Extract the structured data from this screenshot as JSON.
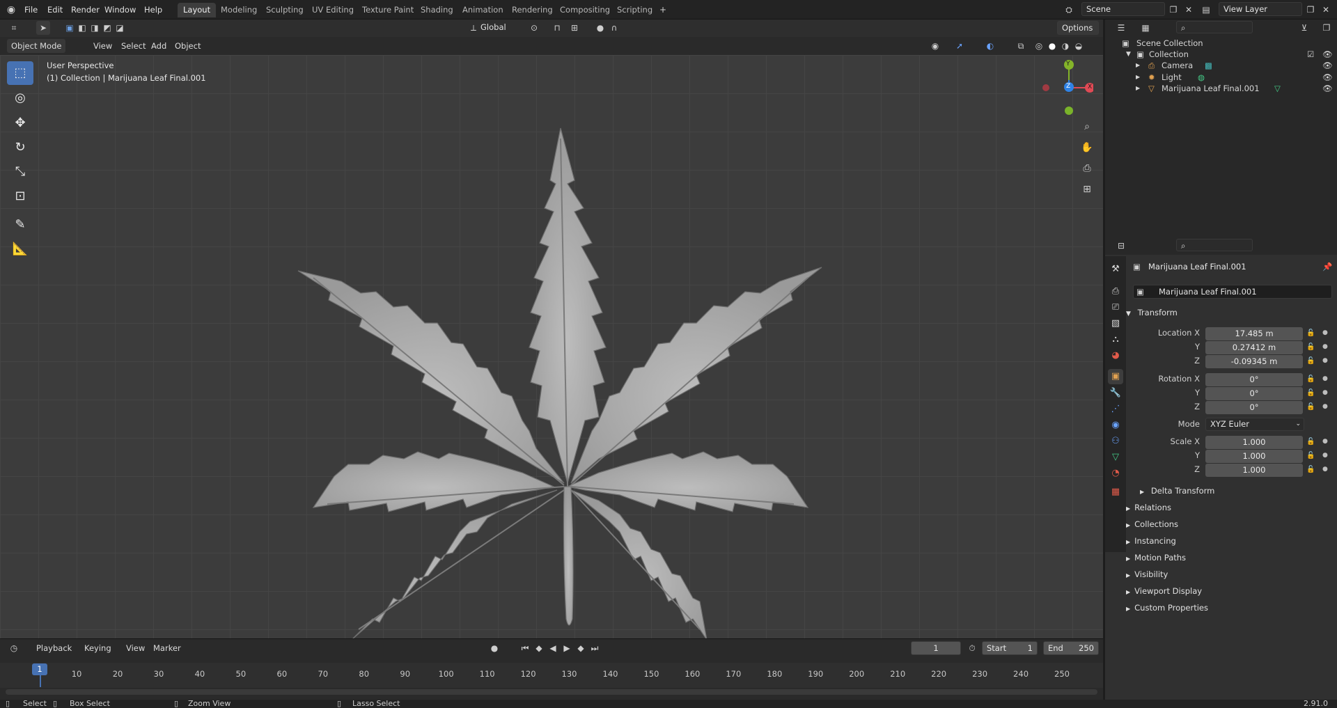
{
  "menu": {
    "file": "File",
    "edit": "Edit",
    "render": "Render",
    "window": "Window",
    "help": "Help"
  },
  "workspaces": [
    "Layout",
    "Modeling",
    "Sculpting",
    "UV Editing",
    "Texture Paint",
    "Shading",
    "Animation",
    "Rendering",
    "Compositing",
    "Scripting"
  ],
  "add_tab_icon": "+",
  "scene": {
    "name": "Scene",
    "view_layer": "View Layer"
  },
  "viewport_header": {
    "mode": "Object Mode",
    "view": "View",
    "select": "Select",
    "add": "Add",
    "object": "Object",
    "orientation": "Global",
    "options": "Options"
  },
  "viewport": {
    "perspective": "User Perspective",
    "collection_info": "(1) Collection | Marijuana Leaf Final.001"
  },
  "gizmo": {
    "x": "X",
    "y": "Y",
    "z": "Z"
  },
  "outliner": {
    "scene_collection": "Scene Collection",
    "collection": "Collection",
    "items": [
      {
        "label": "Camera"
      },
      {
        "label": "Light"
      },
      {
        "label": "Marijuana Leaf Final.001"
      }
    ]
  },
  "properties": {
    "object_name": "Marijuana Leaf Final.001",
    "datablock_name": "Marijuana Leaf Final.001",
    "transform_title": "Transform",
    "location_label": "Location X",
    "y_label": "Y",
    "z_label": "Z",
    "location": {
      "x": "17.485 m",
      "y": "0.27412 m",
      "z": "-0.09345 m"
    },
    "rotation_label": "Rotation X",
    "rotation": {
      "x": "0°",
      "y": "0°",
      "z": "0°"
    },
    "mode_label": "Mode",
    "mode": "XYZ Euler",
    "scale_label": "Scale X",
    "scale": {
      "x": "1.000",
      "y": "1.000",
      "z": "1.000"
    },
    "delta_transform": "Delta Transform",
    "panels": [
      "Relations",
      "Collections",
      "Instancing",
      "Motion Paths",
      "Visibility",
      "Viewport Display",
      "Custom Properties"
    ]
  },
  "timeline": {
    "playback": "Playback",
    "keying": "Keying",
    "view": "View",
    "marker": "Marker",
    "current_frame": "1",
    "start_label": "Start",
    "start": "1",
    "end_label": "End",
    "end": "250",
    "ticks": [
      "10",
      "20",
      "30",
      "40",
      "50",
      "60",
      "70",
      "80",
      "90",
      "100",
      "110",
      "120",
      "130",
      "140",
      "150",
      "160",
      "170",
      "180",
      "190",
      "200",
      "210",
      "220",
      "230",
      "240",
      "250"
    ],
    "playhead": "1"
  },
  "statusbar": {
    "select": "Select",
    "box_select": "Box Select",
    "zoom_view": "Zoom View",
    "lasso_select": "Lasso Select",
    "version": "2.91.0"
  },
  "colors": {
    "accent": "#4772b3",
    "x_axis": "#e04a55",
    "y_axis": "#84b429",
    "z_axis": "#2f83e6",
    "active_tab": "#3d3d3d"
  }
}
